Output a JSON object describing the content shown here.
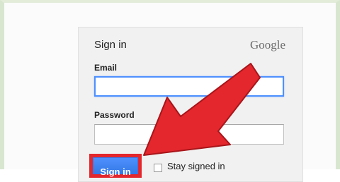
{
  "form": {
    "title": "Sign in",
    "brand": "Google",
    "email_label": "Email",
    "email_value": "",
    "password_label": "Password",
    "password_value": "",
    "signin_label": "Sign in",
    "stay_signed_in_label": "Stay signed in",
    "stay_signed_in_checked": false
  },
  "colors": {
    "accent_blue": "#4d90fe",
    "highlight_red": "#e3272d",
    "frame_green": "#d8e6cf"
  },
  "annotation": {
    "arrow_icon": "red-pointer-arrow-icon",
    "highlight_icon": "red-highlight-box-icon"
  }
}
